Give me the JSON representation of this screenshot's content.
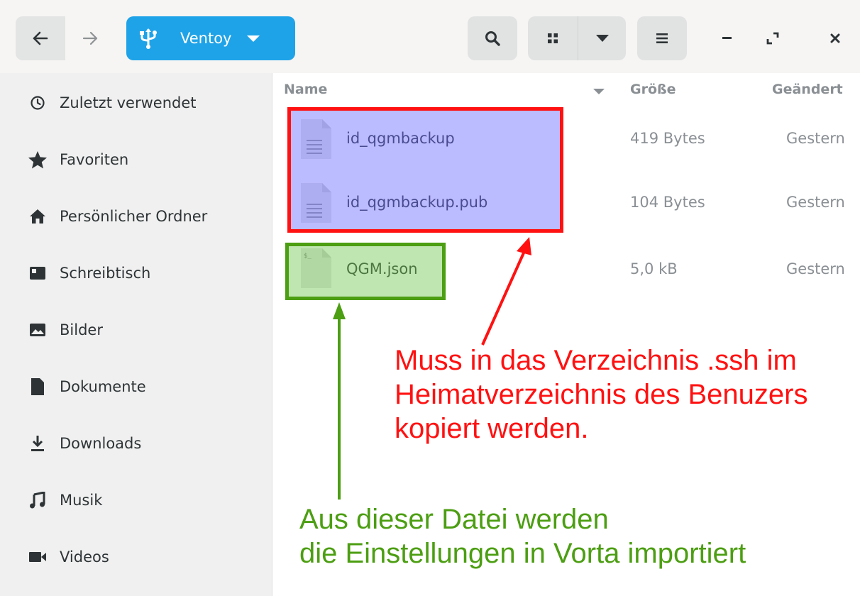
{
  "header": {
    "back_icon": "arrow-left-icon",
    "forward_icon": "arrow-right-icon",
    "path_label": "Ventoy",
    "path_icon": "usb-icon",
    "path_color": "#1fa3e8",
    "search_icon": "search-icon",
    "view_icon": "grid-view-icon",
    "menu_icon": "hamburger-menu-icon"
  },
  "sidebar": {
    "items": [
      {
        "label": "Zuletzt verwendet",
        "icon": "clock-icon"
      },
      {
        "label": "Favoriten",
        "icon": "star-icon"
      },
      {
        "label": "Persönlicher Ordner",
        "icon": "home-icon"
      },
      {
        "label": "Schreibtisch",
        "icon": "desktop-icon"
      },
      {
        "label": "Bilder",
        "icon": "image-icon"
      },
      {
        "label": "Dokumente",
        "icon": "document-icon"
      },
      {
        "label": "Downloads",
        "icon": "download-icon"
      },
      {
        "label": "Musik",
        "icon": "music-icon"
      },
      {
        "label": "Videos",
        "icon": "video-icon"
      }
    ]
  },
  "filelist": {
    "columns": {
      "name": "Name",
      "size": "Größe",
      "modified": "Geändert"
    },
    "files": [
      {
        "name": "id_qgmbackup",
        "size": "419 Bytes",
        "modified": "Gestern",
        "icon": "text-file-icon"
      },
      {
        "name": "id_qgmbackup.pub",
        "size": "104 Bytes",
        "modified": "Gestern",
        "icon": "text-file-icon"
      },
      {
        "name": "QGM.json",
        "size": "5,0 kB",
        "modified": "Gestern",
        "icon": "script-file-icon"
      }
    ]
  },
  "annotations": {
    "red_note": {
      "lines": [
        "Muss in das Verzeichnis .ssh im",
        "Heimatverzeichnis des Benuzers",
        "kopiert werden."
      ],
      "color": "#ff1111"
    },
    "green_note": {
      "lines": [
        "Aus dieser Datei werden",
        "die Einstellungen in Vorta importiert"
      ],
      "color": "#4c9e12"
    }
  }
}
